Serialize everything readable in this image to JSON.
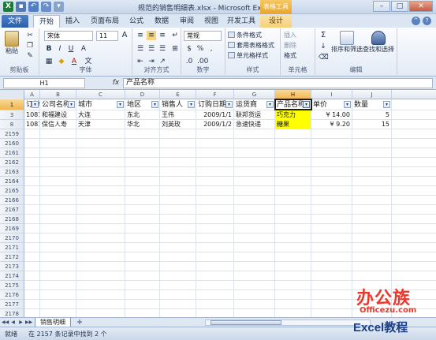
{
  "titlebar": {
    "title": "规范的销售明细表.xlsx - Microsoft Excel",
    "contextual_tab_group": "表格工具",
    "minimize": "–",
    "maximize": "□",
    "close": "✕"
  },
  "ribbon_tabs": [
    "文件",
    "开始",
    "插入",
    "页面布局",
    "公式",
    "数据",
    "审阅",
    "视图",
    "开发工具",
    "设计"
  ],
  "ribbon": {
    "clipboard": {
      "paste": "粘贴",
      "label": "剪贴板"
    },
    "font": {
      "name": "宋体",
      "size": "11",
      "bold": "B",
      "italic": "I",
      "underline": "U",
      "grow": "A",
      "shrink": "A",
      "fontcolor": "A",
      "wen": "文",
      "label": "字体"
    },
    "alignment": {
      "label": "对齐方式"
    },
    "number": {
      "format": "常规",
      "label": "数字"
    },
    "styles": {
      "conditional": "条件格式",
      "table": "套用表格格式",
      "cell": "单元格样式",
      "label": "样式"
    },
    "cells": {
      "insert": "插入",
      "delete": "删除",
      "format": "格式",
      "label": "单元格"
    },
    "editing": {
      "sort": "排序和筛选",
      "find": "查找和选择",
      "sigma": "Σ",
      "label": "编辑"
    }
  },
  "formula_bar": {
    "name_box": "H1",
    "fx": "fx",
    "content": "产品名称"
  },
  "columns": [
    "A",
    "B",
    "C",
    "D",
    "E",
    "F",
    "G",
    "H",
    "I",
    "J"
  ],
  "selected_column": "H",
  "header_row": {
    "row_number": "1",
    "cells": [
      "订单ID",
      "公司名称",
      "城市",
      "地区",
      "销售人",
      "订购日期",
      "运货商",
      "产品名称",
      "单价",
      "数量"
    ]
  },
  "data_rows": [
    {
      "row_number": "3",
      "cells": [
        "10810",
        "和福建设",
        "大连",
        "东北",
        "王伟",
        "2009/1/1",
        "联邦货运",
        "巧克力",
        "¥   14.00",
        "5"
      ]
    },
    {
      "row_number": "8",
      "cells": [
        "10811",
        "保信人寿",
        "天津",
        "华北",
        "刘英玫",
        "2009/1/2",
        "急速快递",
        "糖果",
        "¥    9.20",
        "15"
      ]
    }
  ],
  "empty_rows": [
    "2159",
    "2160",
    "2161",
    "2162",
    "2163",
    "2164",
    "2165",
    "2166",
    "2167",
    "2168",
    "2169",
    "2170",
    "2171",
    "2172",
    "2173",
    "2174",
    "2175",
    "2176",
    "2177",
    "2178",
    "2179",
    "2180"
  ],
  "sheet_tabs": {
    "active": "销售明细"
  },
  "statusbar": {
    "ready": "就绪",
    "filter_info": "在 2157 条记录中找到 2 个"
  },
  "watermark": {
    "top": "办公族",
    "url": "Officezu.com",
    "bottom": "Excel教程"
  },
  "colors": {
    "highlight": "#ffff00",
    "selected_header": "#f5c86b",
    "file_tab": "#2a5ea8",
    "watermark_red": "#e9382c",
    "watermark_blue": "#1a3f8a"
  }
}
